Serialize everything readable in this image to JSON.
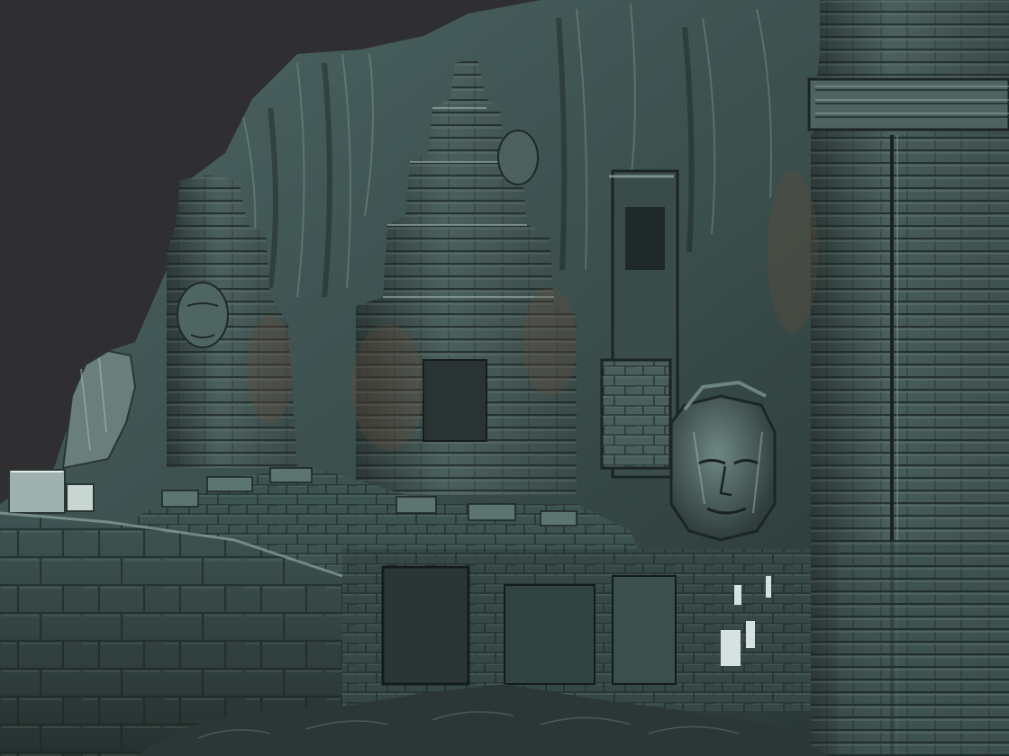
{
  "scene": {
    "subject": "sculpted-stone-temple-ruins",
    "palette": {
      "background": "#2f2f31",
      "stone_dark": "#24302e",
      "stone_mid": "#3d5250",
      "stone_light": "#5d7674",
      "highlight": "#9fb8b4",
      "warm_shadow": "#4a3a30"
    }
  }
}
